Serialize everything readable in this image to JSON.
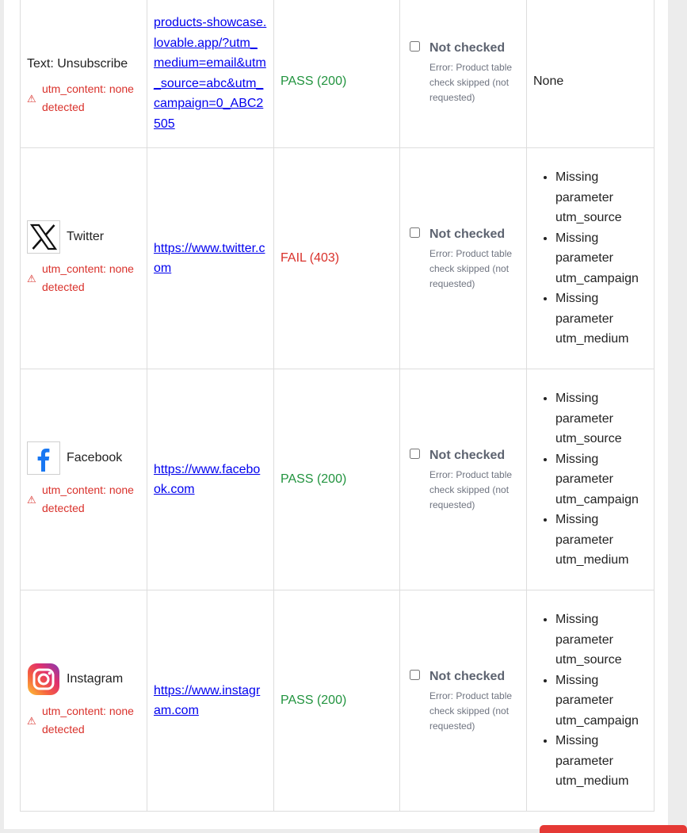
{
  "rows": [
    {
      "source_text": "Text: Unsubscribe",
      "warning": "utm_content: none detected",
      "link": "products-showcase.lovable.app/?utm_medium=email&utm_source=abc&utm_campaign=0_ABC2505",
      "status": "PASS (200)",
      "check_title": "Not checked",
      "check_error": "Error: Product table check skipped (not requested)",
      "issues_text": "None"
    },
    {
      "source_name": "Twitter",
      "icon": "x-twitter-logo-icon",
      "warning": "utm_content: none detected",
      "link": "https://www.twitter.com",
      "status": "FAIL (403)",
      "check_title": "Not checked",
      "check_error": "Error: Product table check skipped (not requested)",
      "issues": [
        "Missing parameter utm_source",
        "Missing parameter utm_campaign",
        "Missing parameter utm_medium"
      ]
    },
    {
      "source_name": "Facebook",
      "icon": "facebook-logo-icon",
      "warning": "utm_content: none detected",
      "link": "https://www.facebook.com",
      "status": "PASS (200)",
      "check_title": "Not checked",
      "check_error": "Error: Product table check skipped (not requested)",
      "issues": [
        "Missing parameter utm_source",
        "Missing parameter utm_campaign",
        "Missing parameter utm_medium"
      ]
    },
    {
      "source_name": "Instagram",
      "icon": "instagram-logo-icon",
      "warning": "utm_content: none detected",
      "link": "https://www.instagram.com",
      "status": "PASS (200)",
      "check_title": "Not checked",
      "check_error": "Error: Product table check skipped (not requested)",
      "issues": [
        "Missing parameter utm_source",
        "Missing parameter utm_campaign",
        "Missing parameter utm_medium"
      ]
    }
  ],
  "colors": {
    "pass": "#21933e",
    "fail": "#d9312b",
    "warning": "#d9312b",
    "link": "#0000ee"
  }
}
